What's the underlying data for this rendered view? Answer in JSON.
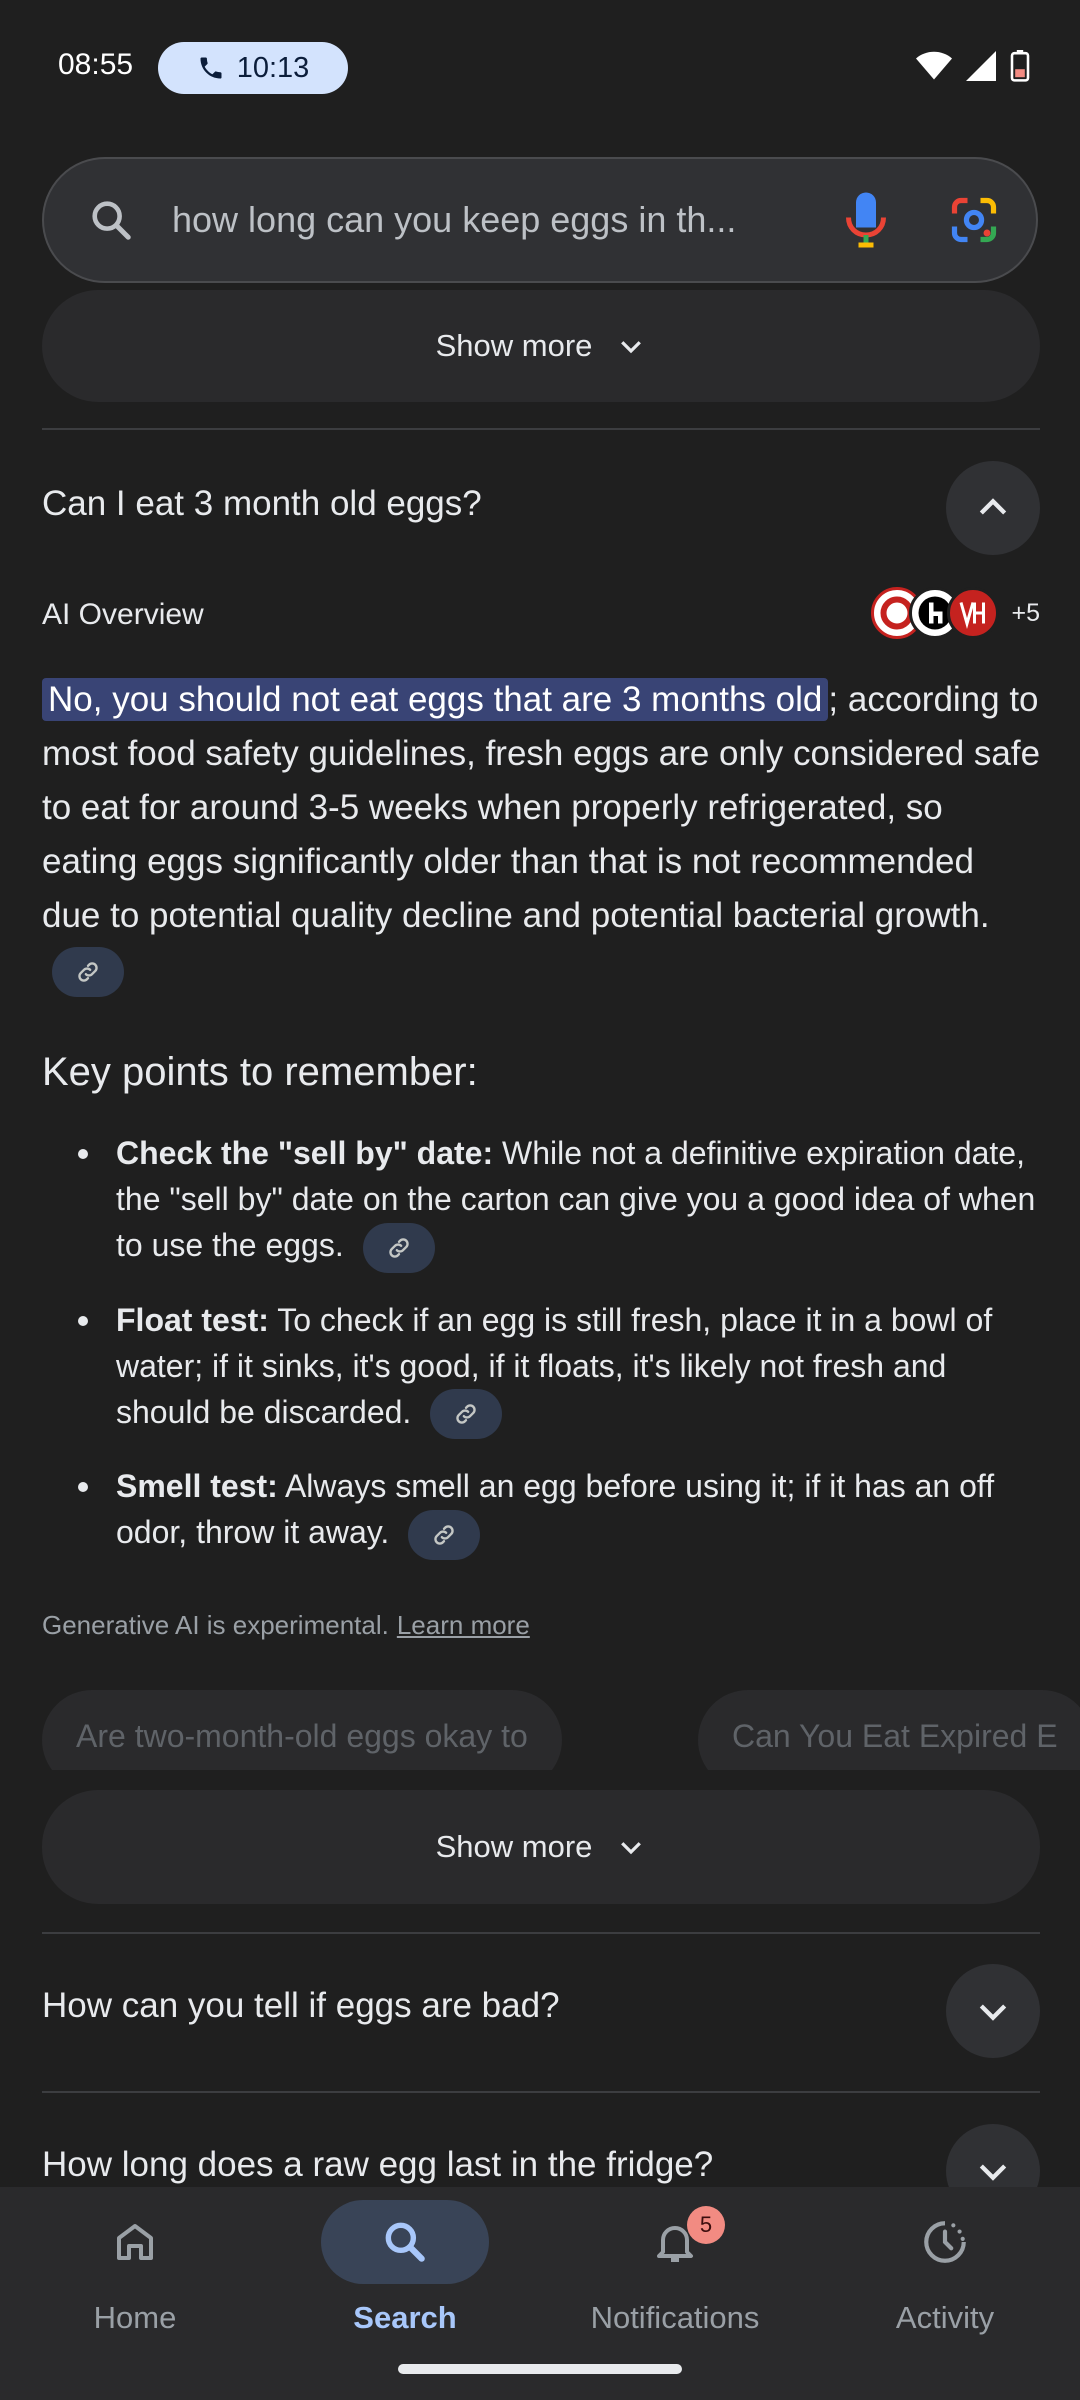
{
  "status_bar": {
    "time": "08:55",
    "call_time": "10:13"
  },
  "search": {
    "query": "how long can you keep eggs in th..."
  },
  "show_more_label": "Show more",
  "questions": [
    "Can I eat 3 month old eggs?",
    "How can you tell if eggs are bad?",
    "How long does a raw egg last in the fridge?"
  ],
  "ai_overview": {
    "label": "AI Overview",
    "sources_extra": "+5",
    "highlighted": "No, you should not eat eggs that are 3 months old",
    "body": "; according to most food safety guidelines, fresh eggs are only considered safe to eat for around 3-5 weeks when properly refrigerated, so eating eggs significantly older than that is not recommended due to potential quality decline and potential bacterial growth.",
    "key_points_title": "Key points to remember:",
    "points": [
      {
        "title": "Check the \"sell by\" date:",
        "text": " While not a definitive expiration date, the \"sell by\" date on the carton can give you a good idea of when to use the eggs."
      },
      {
        "title": "Float test:",
        "text": " To check if an egg is still fresh, place it in a bowl of water; if it sinks, it's good, if it floats, it's likely not fresh and should be discarded."
      },
      {
        "title": "Smell test:",
        "text": " Always smell an egg before using it; if it has an off odor, throw it away."
      }
    ],
    "disclaimer": "Generative AI is experimental.",
    "learn_more": "Learn more"
  },
  "related_chips": [
    "Are two-month-old eggs okay to",
    "Can You Eat Expired E"
  ],
  "nav": {
    "home": "Home",
    "search": "Search",
    "notifications": "Notifications",
    "notifications_badge": "5",
    "activity": "Activity"
  },
  "colors": {
    "accent": "#a8c7fa",
    "highlight": "#394475",
    "background": "#1f1f1f"
  }
}
